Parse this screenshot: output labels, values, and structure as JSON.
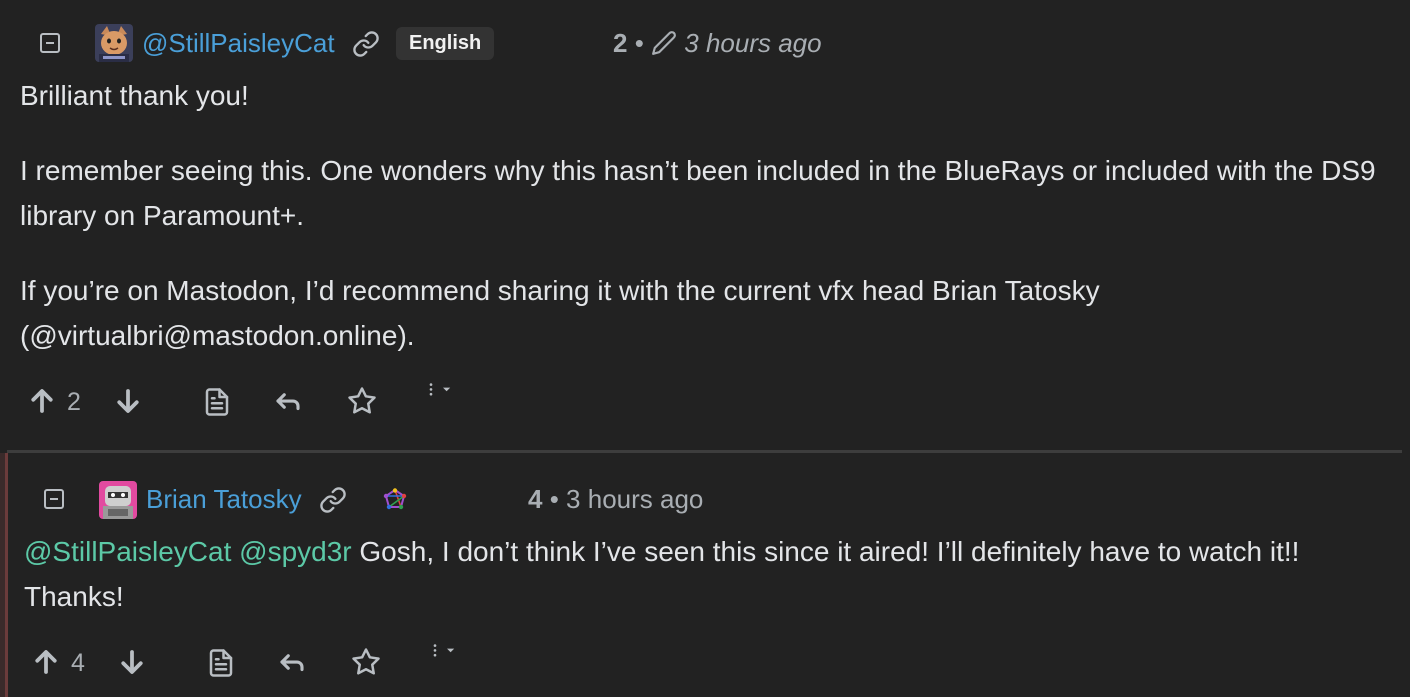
{
  "comments": [
    {
      "username": "@StillPaisleyCat",
      "language": "English",
      "score": "2",
      "time": "3 hours ago",
      "paragraphs": [
        "Brilliant thank you!",
        "I remember seeing this. One wonders why this hasn’t been included in the BlueRays or included with the DS9 library on Paramount+.",
        "If you’re on Mastodon, I’d recommend sharing it with the current vfx head Brian Tatosky (@virtualbri@mastodon.online)."
      ],
      "upvotes": "2"
    },
    {
      "username": "Brian Tatosky",
      "score": "4",
      "time": "3 hours ago",
      "mentions": [
        "@StillPaisleyCat",
        "@spyd3r"
      ],
      "text": " Gosh, I don’t think I’ve seen this since it aired! I’ll definitely have to watch it!! Thanks!",
      "upvotes": "4"
    }
  ],
  "separators": {
    "dot": "•"
  },
  "icons": {
    "collapse": "minus-square-icon",
    "link": "link-icon",
    "edit": "pencil-icon",
    "upvote": "arrow-up-icon",
    "downvote": "arrow-down-icon",
    "source": "file-text-icon",
    "reply": "reply-icon",
    "save": "star-icon",
    "more": "more-vertical-icon",
    "dropdown": "caret-down-icon",
    "instance": "fediverse-icon"
  },
  "colors": {
    "background": "#222222",
    "username": "#4a9fd8",
    "mention": "#5cc9a7",
    "text": "#e3e5e8",
    "muted": "#a9aeb3"
  }
}
